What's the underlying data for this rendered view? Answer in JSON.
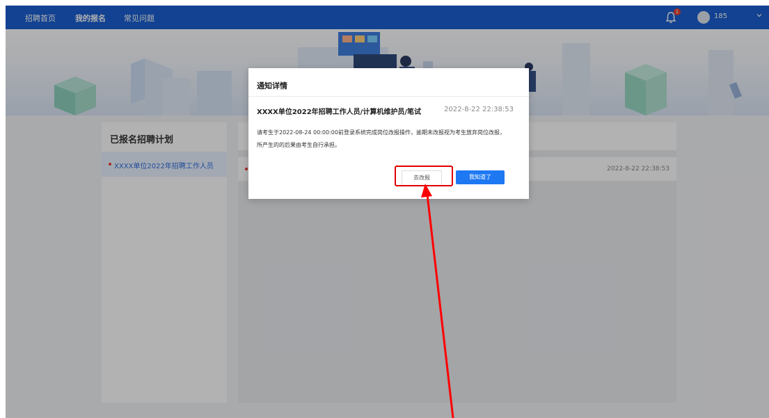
{
  "nav": {
    "items": [
      {
        "label": "招聘首页",
        "active": false
      },
      {
        "label": "我的报名",
        "active": true
      },
      {
        "label": "常见问题",
        "active": false
      }
    ],
    "badge_count": "1",
    "username": "185"
  },
  "sidebar": {
    "title": "已报名招聘计划",
    "items": [
      {
        "label": "XXXX单位2022年招聘工作人员"
      }
    ]
  },
  "list": {
    "rows": [
      {
        "time": "2022-8-22 22:38:53"
      }
    ]
  },
  "modal": {
    "title": "通知详情",
    "subject": "XXXX单位2022年招聘工作人员/计算机维护员/笔试",
    "time": "2022-8-22 22:38:53",
    "body_line1": "请考生于2022-08-24 00:00:00前登录系统完成岗位改报操作，逾期未改报视为考生放弃岗位改报，",
    "body_line2": "所产生的的后果由考生自行承担。",
    "modify_button": "去改报",
    "ok_button": "我知道了"
  },
  "colors": {
    "nav_bg": "#1a5fd0",
    "primary": "#1d78f2",
    "highlight": "#e10000",
    "badge": "#e8412f"
  }
}
